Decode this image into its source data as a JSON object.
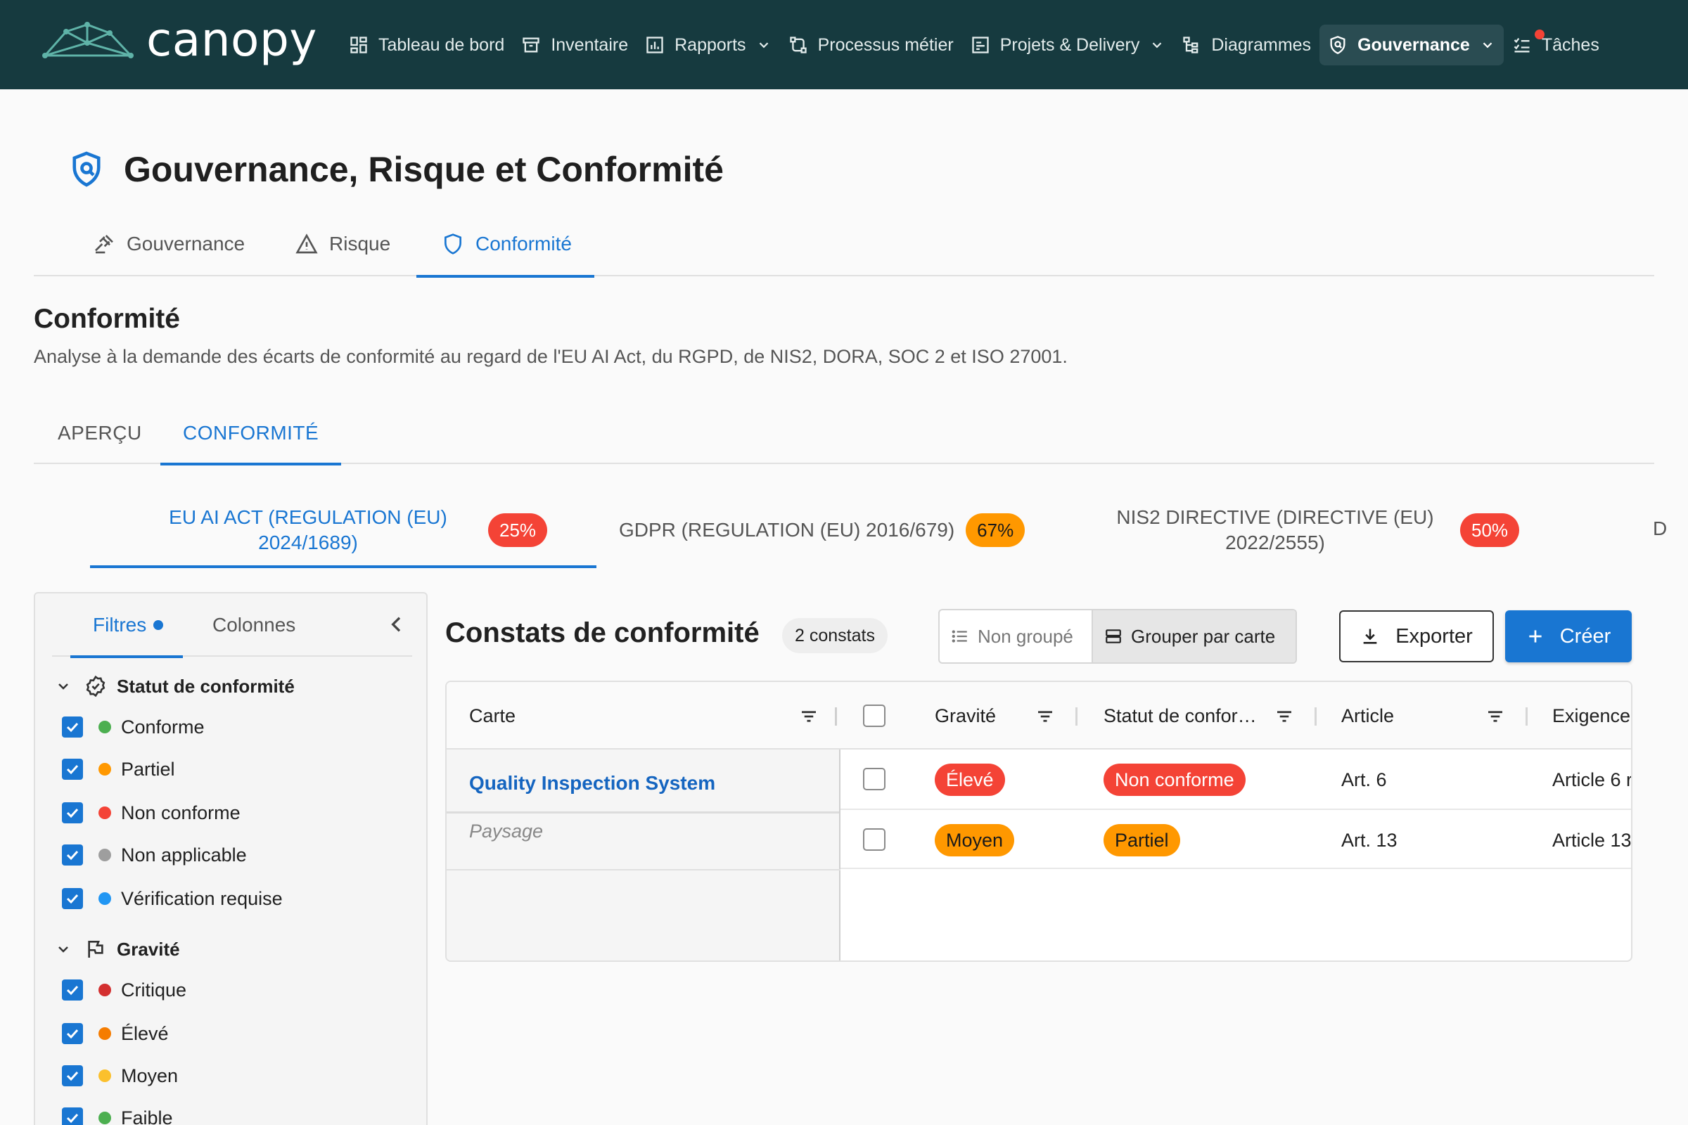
{
  "brand": {
    "name": "canopy"
  },
  "nav": {
    "items": [
      {
        "label": "Tableau de bord",
        "icon": "dashboard-icon"
      },
      {
        "label": "Inventaire",
        "icon": "archive-icon"
      },
      {
        "label": "Rapports",
        "icon": "report-icon",
        "dropdown": true
      },
      {
        "label": "Processus métier",
        "icon": "process-icon"
      },
      {
        "label": "Projets & Delivery",
        "icon": "project-icon",
        "dropdown": true
      },
      {
        "label": "Diagrammes",
        "icon": "diagram-icon"
      },
      {
        "label": "Gouvernance",
        "icon": "shield-icon",
        "dropdown": true,
        "active": true
      },
      {
        "label": "Tâches",
        "icon": "tasks-icon",
        "notification": true
      }
    ]
  },
  "page": {
    "title": "Gouvernance, Risque et Conformité"
  },
  "top_tabs": [
    {
      "label": "Gouvernance",
      "icon": "gavel-icon"
    },
    {
      "label": "Risque",
      "icon": "warning-icon"
    },
    {
      "label": "Conformité",
      "icon": "shield-icon",
      "active": true
    }
  ],
  "section": {
    "title": "Conformité",
    "description": "Analyse à la demande des écarts de conformité au regard de l'EU AI Act, du RGPD, de NIS2, DORA, SOC 2 et ISO 27001."
  },
  "sub_tabs": [
    {
      "label": "APERÇU"
    },
    {
      "label": "CONFORMITÉ",
      "active": true
    }
  ],
  "regulation_tabs": [
    {
      "line1": "EU AI ACT (REGULATION (EU)",
      "line2": "2024/1689)",
      "score": "25%",
      "color": "#f44336",
      "active": true
    },
    {
      "line1": "GDPR (REGULATION (EU) 2016/679)",
      "line2": "",
      "score": "67%",
      "color": "#ff9800"
    },
    {
      "line1": "NIS2 DIRECTIVE (DIRECTIVE (EU)",
      "line2": "2022/2555)",
      "score": "50%",
      "color": "#f44336"
    }
  ],
  "regulation_more": "D",
  "filters": {
    "tab_filters": "Filtres",
    "tab_columns": "Colonnes",
    "groups": [
      {
        "title": "Statut de conformité",
        "icon": "verified-icon",
        "options": [
          {
            "label": "Conforme",
            "color": "#4caf50",
            "checked": true
          },
          {
            "label": "Partiel",
            "color": "#ff9800",
            "checked": true
          },
          {
            "label": "Non conforme",
            "color": "#f44336",
            "checked": true
          },
          {
            "label": "Non applicable",
            "color": "#9e9e9e",
            "checked": true
          },
          {
            "label": "Vérification requise",
            "color": "#2196f3",
            "checked": true
          }
        ]
      },
      {
        "title": "Gravité",
        "icon": "flag-icon",
        "options": [
          {
            "label": "Critique",
            "color": "#d32f2f",
            "checked": true
          },
          {
            "label": "Élevé",
            "color": "#f57c00",
            "checked": true
          },
          {
            "label": "Moyen",
            "color": "#fbc02d",
            "checked": true
          },
          {
            "label": "Faible",
            "color": "#4caf50",
            "checked": true
          }
        ]
      }
    ]
  },
  "findings": {
    "title": "Constats de conformité",
    "count": "2 constats",
    "group_ungrouped": "Non groupé",
    "group_by_card": "Grouper par carte",
    "export_label": "Exporter",
    "create_label": "Créer",
    "columns": [
      "Carte",
      "Gravité",
      "Statut de confor…",
      "Article",
      "Exigence"
    ],
    "card": {
      "name": "Quality Inspection System",
      "type": "Paysage"
    },
    "rows": [
      {
        "severity": "Élevé",
        "severity_color": "#f44336",
        "status": "Non conforme",
        "status_color": "#f44336",
        "article": "Art. 6",
        "requirement": "Article 6 r"
      },
      {
        "severity": "Moyen",
        "severity_color": "#ff9800",
        "status": "Partiel",
        "status_color": "#ff9800",
        "article": "Art. 13",
        "requirement": "Article 13"
      }
    ]
  },
  "colors": {
    "nav_bg": "#163a3f",
    "accent": "#1976d2"
  }
}
